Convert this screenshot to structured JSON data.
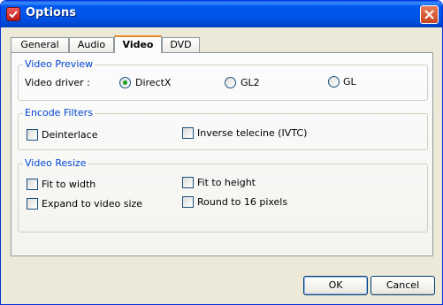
{
  "window": {
    "title": "Options"
  },
  "tabs": [
    "General",
    "Audio",
    "Video",
    "DVD"
  ],
  "active_tab": "Video",
  "video_preview": {
    "label": "Video Preview",
    "driver_label": "Video driver :",
    "options": [
      "DirectX",
      "GL2",
      "GL"
    ],
    "selected": "DirectX"
  },
  "encode_filters": {
    "label": "Encode Filters",
    "deinterlace": "Deinterlace",
    "inverse_telecine": "Inverse telecine (IVTC)"
  },
  "video_resize": {
    "label": "Video Resize",
    "fit_width": "Fit to width",
    "fit_height": "Fit to height",
    "expand": "Expand to video size",
    "round16": "Round to 16 pixels"
  },
  "buttons": {
    "ok": "OK",
    "cancel": "Cancel"
  },
  "colors": {
    "title_bar": "#0054e3",
    "group_label": "#0046d5",
    "active_tab_accent": "#e68b2c",
    "radio_dot": "#21a121"
  }
}
